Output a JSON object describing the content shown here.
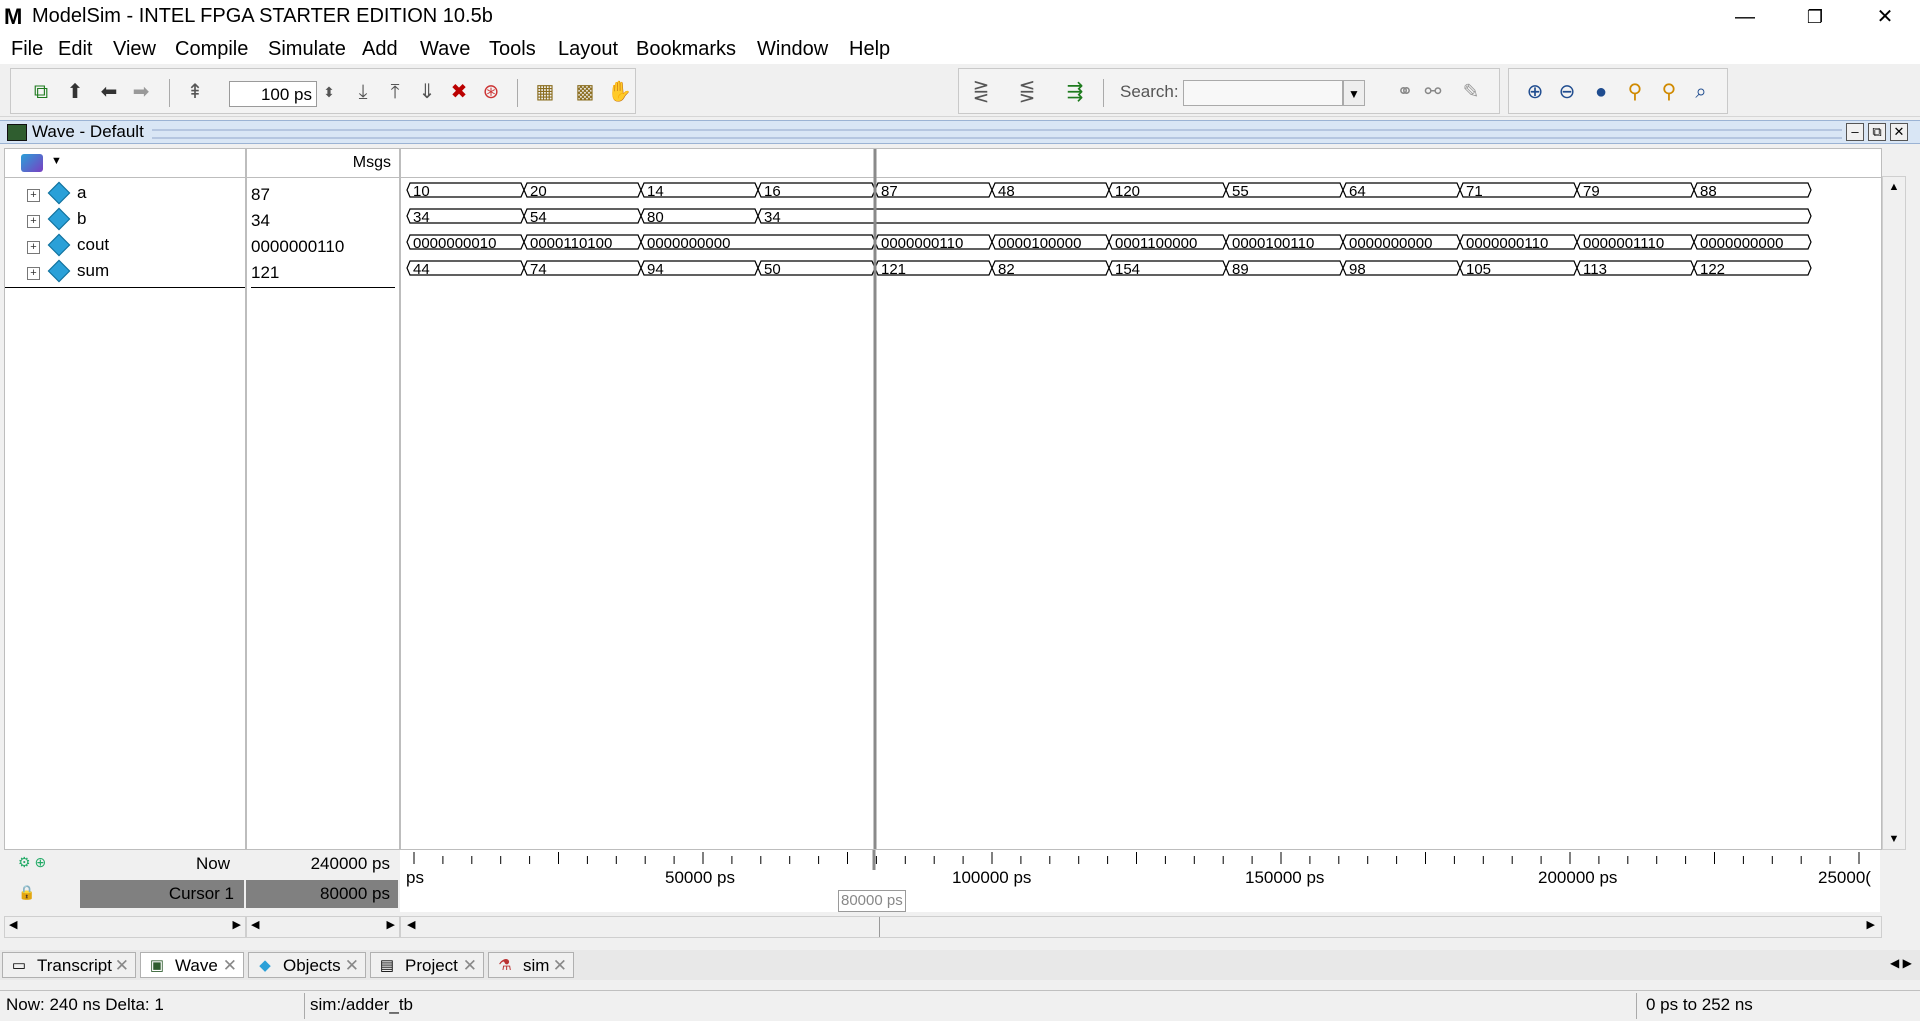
{
  "window": {
    "title": "ModelSim - INTEL FPGA STARTER EDITION 10.5b",
    "logo": "M",
    "controls": {
      "minimize": "—",
      "restore": "❐",
      "close": "✕"
    }
  },
  "menu": [
    "File",
    "Edit",
    "View",
    "Compile",
    "Simulate",
    "Add",
    "Wave",
    "Tools",
    "Layout",
    "Bookmarks",
    "Window",
    "Help"
  ],
  "toolbar": {
    "time_step": "100 ps",
    "search_label": "Search:",
    "search_value": ""
  },
  "wave_window": {
    "title": "Wave - Default",
    "msgs_header": "Msgs"
  },
  "signals": [
    {
      "name": "a",
      "value": "87",
      "segments": [
        "10",
        "20",
        "14",
        "16",
        "87",
        "48",
        "120",
        "55",
        "64",
        "71",
        "79",
        "88"
      ]
    },
    {
      "name": "b",
      "value": "34",
      "segments": [
        "34",
        "54",
        "80",
        "34"
      ]
    },
    {
      "name": "cout",
      "value": "0000000110",
      "segments": [
        "0000000010",
        "0000110100",
        "0000000000",
        "0000000110",
        "0000100000",
        "0001100000",
        "0000100110",
        "0000000000",
        "0000000110",
        "0000001110",
        "0000000000"
      ]
    },
    {
      "name": "sum",
      "value": "121",
      "segments": [
        "44",
        "74",
        "94",
        "50",
        "121",
        "82",
        "154",
        "89",
        "98",
        "105",
        "113",
        "122"
      ]
    }
  ],
  "status_rows": {
    "now_label": "Now",
    "now_value": "240000 ps",
    "cursor_label": "Cursor 1",
    "cursor_value": "80000 ps",
    "cursor_marker": "80000 ps"
  },
  "timeline": {
    "labels": [
      "ps",
      "50000 ps",
      "100000 ps",
      "150000 ps",
      "200000 ps",
      "25000("
    ]
  },
  "tabs": [
    {
      "label": "Transcript",
      "icon": "transcript-icon",
      "active": false
    },
    {
      "label": "Wave",
      "icon": "wave-icon",
      "active": true
    },
    {
      "label": "Objects",
      "icon": "objects-icon",
      "active": false
    },
    {
      "label": "Project",
      "icon": "project-icon",
      "active": false
    },
    {
      "label": "sim",
      "icon": "sim-icon",
      "active": false
    }
  ],
  "statusbar": {
    "now": "Now: 240 ns  Delta: 1",
    "context": "sim:/adder_tb",
    "range": "0 ps to 252 ns"
  }
}
